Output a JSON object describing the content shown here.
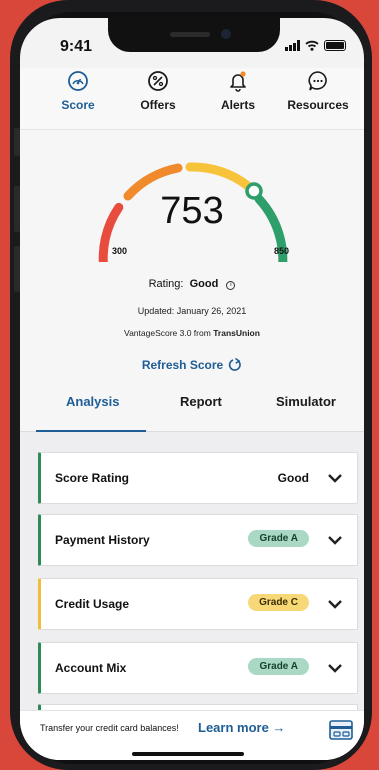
{
  "status": {
    "time": "9:41"
  },
  "nav": [
    {
      "label": "Score",
      "icon": "gauge-icon",
      "active": true
    },
    {
      "label": "Offers",
      "icon": "percent-icon"
    },
    {
      "label": "Alerts",
      "icon": "bell-icon"
    },
    {
      "label": "Resources",
      "icon": "chat-bubble-icon"
    }
  ],
  "score": {
    "value": "753",
    "min": "300",
    "max": "850",
    "rating_label": "Rating:",
    "rating_value": "Good",
    "updated": "Updated: January 26, 2021",
    "source_prefix": "VantageScore 3.0 from",
    "source_brand": "TransUnion",
    "refresh_label": "Refresh Score"
  },
  "tabs": [
    {
      "label": "Analysis",
      "active": true
    },
    {
      "label": "Report"
    },
    {
      "label": "Simulator"
    }
  ],
  "cards": [
    {
      "title": "Score Rating",
      "value": "Good"
    },
    {
      "title": "Payment History",
      "grade": "Grade A"
    },
    {
      "title": "Credit Usage",
      "grade": "Grade C"
    },
    {
      "title": "Account Mix",
      "grade": "Grade A"
    }
  ],
  "banner": {
    "message": "Transfer your credit card balances!",
    "link": "Learn more →"
  },
  "colors": {
    "accent": "#1e5d96",
    "good": "#2e8b57",
    "grade_a_bg": "#a9d9c5",
    "grade_c_bg": "#f7d877",
    "gauge_red": "#e84c3d",
    "gauge_orange": "#f08a2c",
    "gauge_yellow": "#f6c33a",
    "gauge_green": "#2e9e6a"
  }
}
